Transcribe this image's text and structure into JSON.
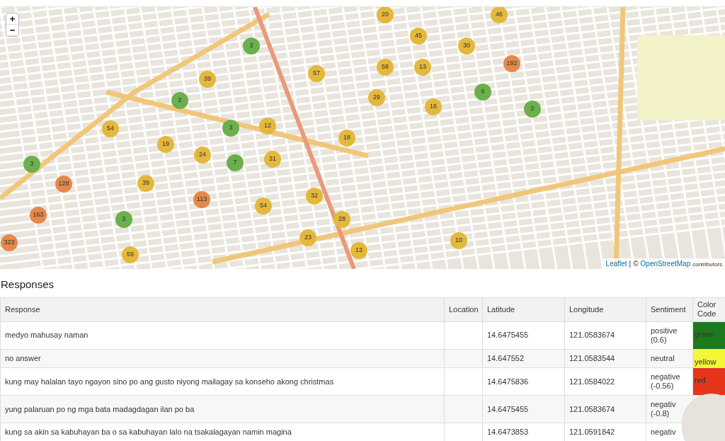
{
  "map": {
    "zoom_controls": [
      "+",
      "−"
    ],
    "clusters": [
      {
        "count": "20",
        "color": "#e3b83c"
      },
      {
        "count": "46",
        "color": "#e3b83c"
      },
      {
        "count": "45",
        "color": "#e3b83c"
      },
      {
        "count": "30",
        "color": "#e3b83c"
      },
      {
        "count": "58",
        "color": "#e3b83c"
      },
      {
        "count": "13",
        "color": "#e3b83c"
      },
      {
        "count": "192",
        "color": "#e6884a"
      },
      {
        "count": "29",
        "color": "#e3b83c"
      },
      {
        "count": "6",
        "color": "#6ab04c"
      },
      {
        "count": "16",
        "color": "#e3b83c"
      },
      {
        "count": "2",
        "color": "#6ab04c"
      },
      {
        "count": "3",
        "color": "#6ab04c"
      },
      {
        "count": "57",
        "color": "#e3b83c"
      },
      {
        "count": "39",
        "color": "#e3b83c"
      },
      {
        "count": "2",
        "color": "#6ab04c"
      },
      {
        "count": "54",
        "color": "#e3b83c"
      },
      {
        "count": "3",
        "color": "#6ab04c"
      },
      {
        "count": "12",
        "color": "#e3b83c"
      },
      {
        "count": "18",
        "color": "#e3b83c"
      },
      {
        "count": "19",
        "color": "#e3b83c"
      },
      {
        "count": "24",
        "color": "#e3b83c"
      },
      {
        "count": "7",
        "color": "#6ab04c"
      },
      {
        "count": "31",
        "color": "#e3b83c"
      },
      {
        "count": "3",
        "color": "#6ab04c"
      },
      {
        "count": "128",
        "color": "#e6884a"
      },
      {
        "count": "39",
        "color": "#e3b83c"
      },
      {
        "count": "113",
        "color": "#e6884a"
      },
      {
        "count": "54",
        "color": "#e3b83c"
      },
      {
        "count": "32",
        "color": "#e3b83c"
      },
      {
        "count": "163",
        "color": "#e6884a"
      },
      {
        "count": "3",
        "color": "#6ab04c"
      },
      {
        "count": "28",
        "color": "#e3b83c"
      },
      {
        "count": "23",
        "color": "#e3b83c"
      },
      {
        "count": "13",
        "color": "#e3b83c"
      },
      {
        "count": "10",
        "color": "#e3b83c"
      },
      {
        "count": "59",
        "color": "#e3b83c"
      },
      {
        "count": "323",
        "color": "#e6884a"
      }
    ],
    "attribution": {
      "leaflet": "Leaflet",
      "separator": "|",
      "copyright": "©",
      "osm": "OpenStreetMap",
      "suffix": "contributors"
    }
  },
  "section_title": "Responses",
  "table": {
    "columns": [
      "Response",
      "Location",
      "Latitude",
      "Longitude",
      "Sentiment",
      "Color Code"
    ],
    "rows": [
      {
        "response": "medyo mahusay naman",
        "latitude": "14.6475455",
        "longitude": "121.0583674",
        "sentiment": "positive (0.6)",
        "color_code": {
          "label": "green",
          "color": "#1e7a1e"
        }
      },
      {
        "response": "no answer",
        "latitude": "14.647552",
        "longitude": "121.0583544",
        "sentiment": "neutral",
        "color_code": {
          "label": "yellow",
          "color": "#f5f53a"
        }
      },
      {
        "response": "kung may halalan tayo ngayon sino po ang gusto niyong mailagay sa konseho akong christmas",
        "latitude": "14.6475836",
        "longitude": "121.0584022",
        "sentiment": "negative (-0.56)",
        "color_code": {
          "label": "red",
          "color": "#e5361c"
        }
      },
      {
        "response": "yung palaruan po ng mga bata madagdagan ilan po ba",
        "latitude": "14.6475455",
        "longitude": "121.0583674",
        "sentiment": "negativ (-0.8)"
      },
      {
        "response": "kung sa akin sa kabuhayan ba o sa kabuhayan lalo na tsakalagayan namin magina",
        "latitude": "14.6473853",
        "longitude": "121.0591842",
        "sentiment": "negativ"
      }
    ]
  }
}
